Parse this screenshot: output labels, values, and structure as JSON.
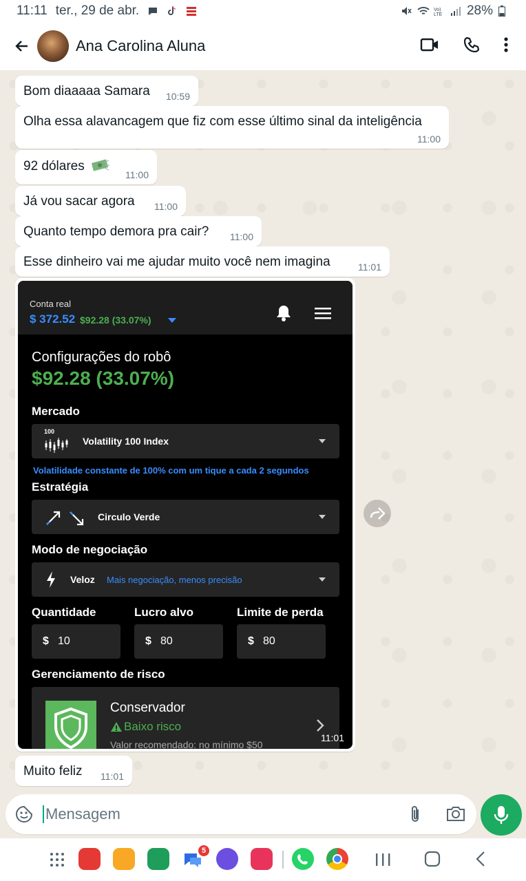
{
  "status_bar": {
    "time": "11:11",
    "date": "ter., 29 de abr.",
    "battery": "28%"
  },
  "header": {
    "contact_name": "Ana Carolina Aluna"
  },
  "messages": [
    {
      "text": "Bom diaaaaa Samara",
      "time": "10:59"
    },
    {
      "text": "Olha essa alavancagem que fiz com esse último sinal da inteligência",
      "time": "11:00"
    },
    {
      "text": "92 dólares",
      "time": "11:00"
    },
    {
      "text": "Já vou sacar agora",
      "time": "11:00"
    },
    {
      "text": "Quanto tempo demora pra cair?",
      "time": "11:00"
    },
    {
      "text": "Esse dinheiro vai me ajudar muito você nem imagina",
      "time": "11:01"
    },
    {
      "text": "Muito feliz",
      "time": "11:01"
    }
  ],
  "image_message": {
    "time": "11:01",
    "screenshot": {
      "account_label": "Conta real",
      "balance": "$ 372.52",
      "balance_gain": "$92.28 (33.07%)",
      "config_title": "Configurações do robô",
      "config_profit": "$92.28 (33.07%)",
      "market_label": "Mercado",
      "market_value": "Volatility 100 Index",
      "market_badge": "100",
      "market_hint": "Volatilidade constante de 100% com um tique a cada 2 segundos",
      "strategy_label": "Estratégia",
      "strategy_value": "Circulo Verde",
      "mode_label": "Modo de negociação",
      "mode_value": "Veloz",
      "mode_hint": "Mais negociação, menos precisão",
      "quantity_label": "Quantidade",
      "quantity_currency": "$",
      "quantity_value": "10",
      "target_label": "Lucro alvo",
      "target_currency": "$",
      "target_value": "80",
      "loss_label": "Limite de perda",
      "loss_currency": "$",
      "loss_value": "80",
      "risk_label": "Gerenciamento de risco",
      "risk_name": "Conservador",
      "risk_level": "Baixo risco",
      "risk_recommendation": "Valor recomendado: no mínimo $50"
    }
  },
  "composer": {
    "placeholder": "Mensagem"
  },
  "nav": {
    "messages_badge": "5"
  },
  "colors": {
    "accent_green": "#1daa61",
    "profit_green": "#4caf50",
    "link_blue": "#3a8dff",
    "chat_bg": "#efeae2"
  }
}
